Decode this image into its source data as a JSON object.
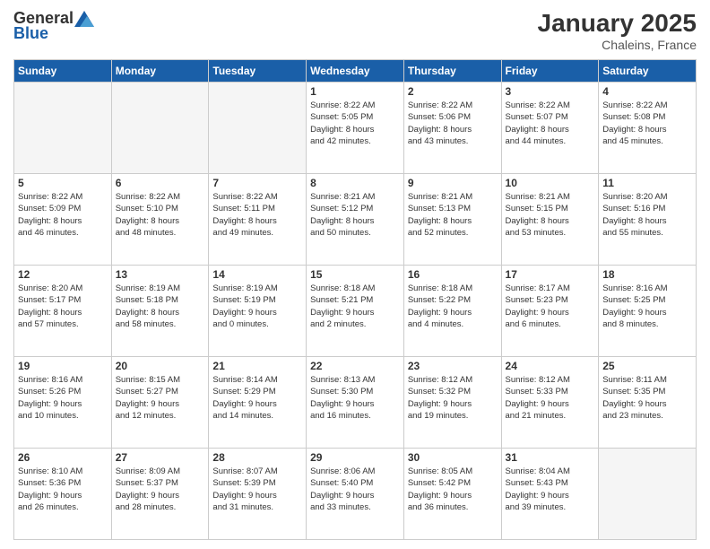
{
  "header": {
    "logo_general": "General",
    "logo_blue": "Blue",
    "title": "January 2025",
    "subtitle": "Chaleins, France"
  },
  "days_of_week": [
    "Sunday",
    "Monday",
    "Tuesday",
    "Wednesday",
    "Thursday",
    "Friday",
    "Saturday"
  ],
  "weeks": [
    [
      {
        "day": "",
        "info": ""
      },
      {
        "day": "",
        "info": ""
      },
      {
        "day": "",
        "info": ""
      },
      {
        "day": "1",
        "info": "Sunrise: 8:22 AM\nSunset: 5:05 PM\nDaylight: 8 hours\nand 42 minutes."
      },
      {
        "day": "2",
        "info": "Sunrise: 8:22 AM\nSunset: 5:06 PM\nDaylight: 8 hours\nand 43 minutes."
      },
      {
        "day": "3",
        "info": "Sunrise: 8:22 AM\nSunset: 5:07 PM\nDaylight: 8 hours\nand 44 minutes."
      },
      {
        "day": "4",
        "info": "Sunrise: 8:22 AM\nSunset: 5:08 PM\nDaylight: 8 hours\nand 45 minutes."
      }
    ],
    [
      {
        "day": "5",
        "info": "Sunrise: 8:22 AM\nSunset: 5:09 PM\nDaylight: 8 hours\nand 46 minutes."
      },
      {
        "day": "6",
        "info": "Sunrise: 8:22 AM\nSunset: 5:10 PM\nDaylight: 8 hours\nand 48 minutes."
      },
      {
        "day": "7",
        "info": "Sunrise: 8:22 AM\nSunset: 5:11 PM\nDaylight: 8 hours\nand 49 minutes."
      },
      {
        "day": "8",
        "info": "Sunrise: 8:21 AM\nSunset: 5:12 PM\nDaylight: 8 hours\nand 50 minutes."
      },
      {
        "day": "9",
        "info": "Sunrise: 8:21 AM\nSunset: 5:13 PM\nDaylight: 8 hours\nand 52 minutes."
      },
      {
        "day": "10",
        "info": "Sunrise: 8:21 AM\nSunset: 5:15 PM\nDaylight: 8 hours\nand 53 minutes."
      },
      {
        "day": "11",
        "info": "Sunrise: 8:20 AM\nSunset: 5:16 PM\nDaylight: 8 hours\nand 55 minutes."
      }
    ],
    [
      {
        "day": "12",
        "info": "Sunrise: 8:20 AM\nSunset: 5:17 PM\nDaylight: 8 hours\nand 57 minutes."
      },
      {
        "day": "13",
        "info": "Sunrise: 8:19 AM\nSunset: 5:18 PM\nDaylight: 8 hours\nand 58 minutes."
      },
      {
        "day": "14",
        "info": "Sunrise: 8:19 AM\nSunset: 5:19 PM\nDaylight: 9 hours\nand 0 minutes."
      },
      {
        "day": "15",
        "info": "Sunrise: 8:18 AM\nSunset: 5:21 PM\nDaylight: 9 hours\nand 2 minutes."
      },
      {
        "day": "16",
        "info": "Sunrise: 8:18 AM\nSunset: 5:22 PM\nDaylight: 9 hours\nand 4 minutes."
      },
      {
        "day": "17",
        "info": "Sunrise: 8:17 AM\nSunset: 5:23 PM\nDaylight: 9 hours\nand 6 minutes."
      },
      {
        "day": "18",
        "info": "Sunrise: 8:16 AM\nSunset: 5:25 PM\nDaylight: 9 hours\nand 8 minutes."
      }
    ],
    [
      {
        "day": "19",
        "info": "Sunrise: 8:16 AM\nSunset: 5:26 PM\nDaylight: 9 hours\nand 10 minutes."
      },
      {
        "day": "20",
        "info": "Sunrise: 8:15 AM\nSunset: 5:27 PM\nDaylight: 9 hours\nand 12 minutes."
      },
      {
        "day": "21",
        "info": "Sunrise: 8:14 AM\nSunset: 5:29 PM\nDaylight: 9 hours\nand 14 minutes."
      },
      {
        "day": "22",
        "info": "Sunrise: 8:13 AM\nSunset: 5:30 PM\nDaylight: 9 hours\nand 16 minutes."
      },
      {
        "day": "23",
        "info": "Sunrise: 8:12 AM\nSunset: 5:32 PM\nDaylight: 9 hours\nand 19 minutes."
      },
      {
        "day": "24",
        "info": "Sunrise: 8:12 AM\nSunset: 5:33 PM\nDaylight: 9 hours\nand 21 minutes."
      },
      {
        "day": "25",
        "info": "Sunrise: 8:11 AM\nSunset: 5:35 PM\nDaylight: 9 hours\nand 23 minutes."
      }
    ],
    [
      {
        "day": "26",
        "info": "Sunrise: 8:10 AM\nSunset: 5:36 PM\nDaylight: 9 hours\nand 26 minutes."
      },
      {
        "day": "27",
        "info": "Sunrise: 8:09 AM\nSunset: 5:37 PM\nDaylight: 9 hours\nand 28 minutes."
      },
      {
        "day": "28",
        "info": "Sunrise: 8:07 AM\nSunset: 5:39 PM\nDaylight: 9 hours\nand 31 minutes."
      },
      {
        "day": "29",
        "info": "Sunrise: 8:06 AM\nSunset: 5:40 PM\nDaylight: 9 hours\nand 33 minutes."
      },
      {
        "day": "30",
        "info": "Sunrise: 8:05 AM\nSunset: 5:42 PM\nDaylight: 9 hours\nand 36 minutes."
      },
      {
        "day": "31",
        "info": "Sunrise: 8:04 AM\nSunset: 5:43 PM\nDaylight: 9 hours\nand 39 minutes."
      },
      {
        "day": "",
        "info": ""
      }
    ]
  ]
}
